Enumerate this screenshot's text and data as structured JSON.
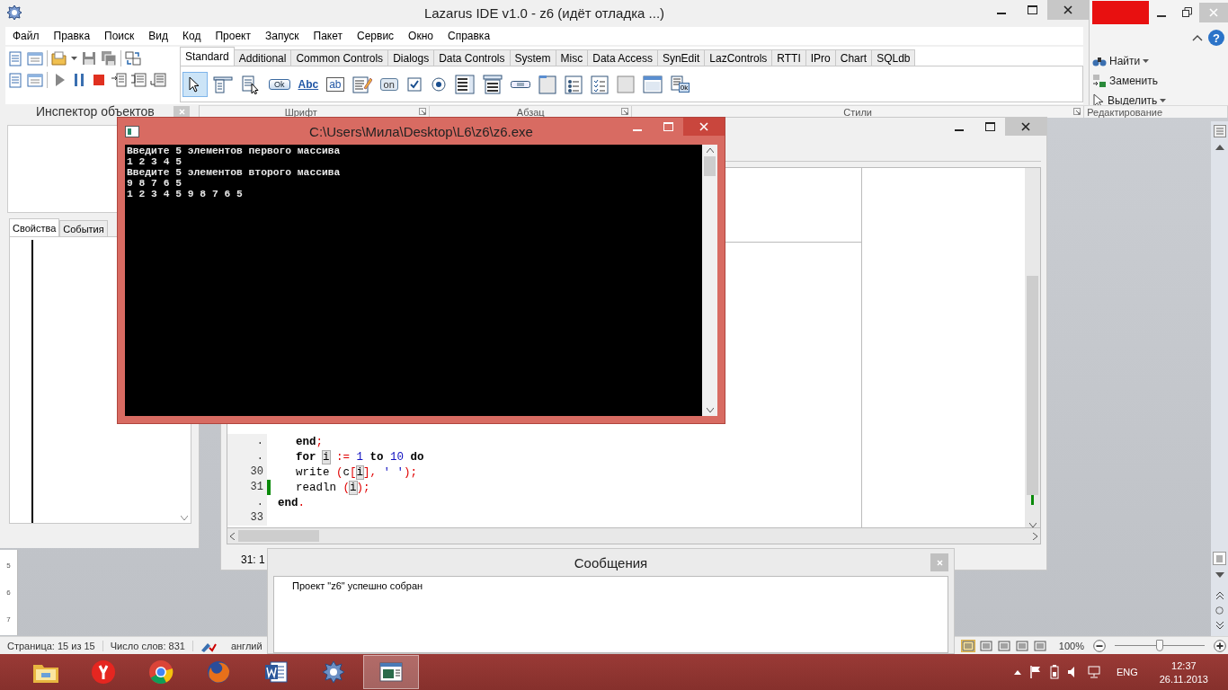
{
  "word": {
    "help": "?",
    "editing_buttons": [
      {
        "label": "Найти",
        "dropdown": true
      },
      {
        "label": "Заменить",
        "dropdown": false
      },
      {
        "label": "Выделить",
        "dropdown": true
      }
    ],
    "ribbon_groups": [
      "Шрифт",
      "Абзац",
      "Стили",
      "Редактирование"
    ],
    "ruler_numbers": [
      "5",
      "6",
      "7"
    ],
    "status_bar": {
      "page": "Страница: 15 из 15",
      "words": "Число слов: 831",
      "language": "англий",
      "zoom": "100%",
      "zoom_slider": {
        "level": 0.5
      }
    }
  },
  "lazarus": {
    "title": "Lazarus IDE v1.0 - z6 (идёт отладка ...)",
    "menu": [
      "Файл",
      "Правка",
      "Поиск",
      "Вид",
      "Код",
      "Проект",
      "Запуск",
      "Пакет",
      "Сервис",
      "Окно",
      "Справка"
    ],
    "palette_tabs": [
      {
        "label": "Standard",
        "selected": true
      },
      {
        "label": "Additional",
        "selected": false
      },
      {
        "label": "Common Controls",
        "selected": false
      },
      {
        "label": "Dialogs",
        "selected": false
      },
      {
        "label": "Data Controls",
        "selected": false
      },
      {
        "label": "System",
        "selected": false
      },
      {
        "label": "Misc",
        "selected": false
      },
      {
        "label": "Data Access",
        "selected": false
      },
      {
        "label": "SynEdit",
        "selected": false
      },
      {
        "label": "LazControls",
        "selected": false
      },
      {
        "label": "RTTI",
        "selected": false
      },
      {
        "label": "IPro",
        "selected": false
      },
      {
        "label": "Chart",
        "selected": false
      },
      {
        "label": "SQLdb",
        "selected": false
      }
    ],
    "palette_items": [
      {
        "kind": "pointer",
        "selected": true
      },
      {
        "kind": "mainmenu",
        "selected": false
      },
      {
        "kind": "popupmenu",
        "selected": false
      },
      {
        "kind": "button",
        "label": "Ok",
        "selected": false
      },
      {
        "kind": "label",
        "label": "Abc",
        "selected": false
      },
      {
        "kind": "edit",
        "label": "ab",
        "selected": false
      },
      {
        "kind": "memo",
        "selected": false
      },
      {
        "kind": "toggle",
        "label": "on",
        "selected": false
      },
      {
        "kind": "checkbox",
        "selected": false
      },
      {
        "kind": "radio",
        "selected": false
      },
      {
        "kind": "listbox",
        "selected": false
      },
      {
        "kind": "combobox",
        "selected": false
      },
      {
        "kind": "scrollbar",
        "selected": false
      },
      {
        "kind": "groupbox",
        "selected": false
      },
      {
        "kind": "radiogroup",
        "selected": false
      },
      {
        "kind": "checkgroup",
        "selected": false
      },
      {
        "kind": "panel",
        "selected": false
      },
      {
        "kind": "frame",
        "selected": false
      },
      {
        "kind": "actionlist",
        "label": "0k",
        "selected": false
      }
    ]
  },
  "inspector": {
    "title": "Инспектор объектов",
    "tabs": [
      {
        "label": "Свойства",
        "selected": true
      },
      {
        "label": "События",
        "selected": false
      }
    ]
  },
  "editor": {
    "lines": [
      {
        "number": ".",
        "indented": true,
        "marked": false,
        "tokens": [
          {
            "kind": "keyword",
            "text": "end",
            "spaced": false
          },
          {
            "kind": "symbol",
            "text": ";",
            "spaced": false
          }
        ]
      },
      {
        "number": ".",
        "indented": true,
        "marked": false,
        "tokens": [
          {
            "kind": "keyword",
            "text": "for",
            "spaced": false
          },
          {
            "kind": "highlight",
            "text": "i",
            "spaced": true
          },
          {
            "kind": "symbol",
            "text": ":=",
            "spaced": true
          },
          {
            "kind": "number",
            "text": "1",
            "spaced": true
          },
          {
            "kind": "keyword",
            "text": "to",
            "spaced": true
          },
          {
            "kind": "number",
            "text": "10",
            "spaced": true
          },
          {
            "kind": "keyword",
            "text": "do",
            "spaced": true
          }
        ]
      },
      {
        "number": "30",
        "indented": true,
        "marked": false,
        "tokens": [
          {
            "kind": "ident",
            "text": "write",
            "spaced": false
          },
          {
            "kind": "symbol",
            "text": "(",
            "spaced": true
          },
          {
            "kind": "ident",
            "text": "c",
            "spaced": false
          },
          {
            "kind": "symbol",
            "text": "[",
            "spaced": false
          },
          {
            "kind": "highlight",
            "text": "i",
            "spaced": false
          },
          {
            "kind": "symbol",
            "text": "],",
            "spaced": false
          },
          {
            "kind": "string",
            "text": "' '",
            "spaced": true
          },
          {
            "kind": "symbol",
            "text": ");",
            "spaced": false
          }
        ]
      },
      {
        "number": "31",
        "indented": true,
        "marked": true,
        "tokens": [
          {
            "kind": "ident",
            "text": "readln",
            "spaced": false
          },
          {
            "kind": "symbol",
            "text": "(",
            "spaced": true
          },
          {
            "kind": "highlight",
            "text": "i",
            "spaced": false
          },
          {
            "kind": "symbol",
            "text": ");",
            "spaced": false
          }
        ]
      },
      {
        "number": ".",
        "indented": false,
        "marked": false,
        "tokens": [
          {
            "kind": "keyword",
            "text": "end",
            "spaced": false
          },
          {
            "kind": "symbol",
            "text": ".",
            "spaced": false
          }
        ]
      },
      {
        "number": "33",
        "marked": false
      }
    ],
    "status": "31: 1"
  },
  "console": {
    "title": "C:\\Users\\Мила\\Desktop\\L6\\z6\\z6.exe",
    "lines": [
      "Введите 5 элементов первого массива",
      "1 2 3 4 5",
      "Введите 5 элементов второго массива",
      "9 8 7 6 5",
      "1 2 3 4 5 9 8 7 6 5"
    ]
  },
  "messages": {
    "title": "Сообщения",
    "items": [
      "Проект \"z6\" успешно собран"
    ]
  },
  "taskbar": {
    "apps": [
      {
        "kind": "explorer",
        "selected": false
      },
      {
        "kind": "yandex",
        "selected": false
      },
      {
        "kind": "chrome",
        "selected": false
      },
      {
        "kind": "firefox",
        "selected": false
      },
      {
        "kind": "word",
        "selected": false
      },
      {
        "kind": "lazarus",
        "selected": false
      },
      {
        "kind": "console",
        "selected": true
      }
    ],
    "tray": {
      "language": "ENG",
      "time": "12:37",
      "date": "26.11.2013"
    }
  }
}
